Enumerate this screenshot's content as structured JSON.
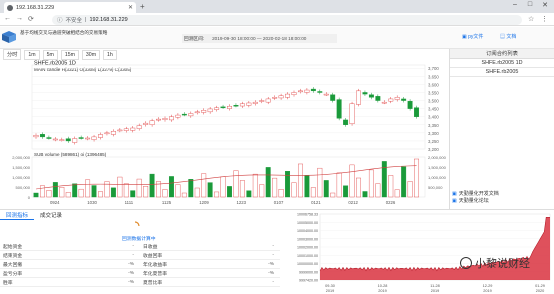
{
  "browser": {
    "tab_title": "192.168.31.229",
    "url": "192.168.31.229",
    "security": "不安全",
    "new_tab": "+",
    "win_min": "–",
    "win_max": "□",
    "win_close": "✕"
  },
  "app": {
    "description": "基于均线交叉与通道突破相结合的交易策略",
    "range_label": "回测区间:",
    "range_value": "2019-09-30 18:00:00 — 2020-02-18 18:00:00",
    "py_btn": "py文件",
    "doc_btn": "文档"
  },
  "timeframes": [
    "分时",
    "1m",
    "5m",
    "15m",
    "30m",
    "1h"
  ],
  "sidebar": {
    "header": "订阅合约列表",
    "items": [
      "SHFE.rb2005 1D",
      "SHFE.rb2005"
    ],
    "foot1": "天勤量化开发文档",
    "foot2": "天勤量化论坛"
  },
  "chart_data": [
    {
      "type": "line",
      "title": "SHFE.rb2005 1D",
      "main_label": "MAIN candle H(3321) O(3308) L(3279) C(3305)",
      "y_ticks": [
        "3,700",
        "3,650",
        "3,600",
        "3,550",
        "3,500",
        "3,450",
        "3,400",
        "3,350",
        "3,300",
        "3,250",
        "3,200"
      ],
      "x_ticks": [
        "0924",
        "1030",
        "1111",
        "1125",
        "1209",
        "1223",
        "0107",
        "0121",
        "0212",
        "0226"
      ],
      "close": [
        3285,
        3275,
        3270,
        3262,
        3258,
        3250,
        3265,
        3270,
        3268,
        3275,
        3290,
        3300,
        3310,
        3318,
        3325,
        3330,
        3345,
        3360,
        3375,
        3385,
        3390,
        3400,
        3410,
        3415,
        3420,
        3430,
        3440,
        3448,
        3455,
        3460,
        3465,
        3470,
        3480,
        3485,
        3490,
        3500,
        3510,
        3520,
        3530,
        3540,
        3550,
        3560,
        3565,
        3560,
        3550,
        3540,
        3500,
        3390,
        3350,
        3480,
        3560,
        3540,
        3520,
        3500,
        3490,
        3510,
        3520,
        3500,
        3450,
        3400
      ],
      "ylim": [
        3200,
        3720
      ]
    },
    {
      "type": "bar",
      "title": "SUB volume (589861) oi (1396485)",
      "y_ticks": [
        "2,000,000",
        "1,500,000",
        "1,000,000",
        "500,000",
        "0"
      ],
      "y2_ticks": [
        "2,000,000",
        "1,500,000",
        "1,000,000",
        "500,000"
      ]
    },
    {
      "type": "line",
      "title": "equity",
      "y_ticks": [
        "10006758.33",
        "10005000.00",
        "10004000.00",
        "10003000.00",
        "10002000.00",
        "10001000.00",
        "10000000.00",
        "9999000.00",
        "9997420.00"
      ],
      "x_ticks": [
        "09-30\n2019",
        "10-28\n2019",
        "11-28\n2019",
        "12-29\n2019",
        "01-29\n2020"
      ]
    }
  ],
  "bottom": {
    "tab1": "回测指标",
    "tab2": "成交记录",
    "loading": "回测数据计算中",
    "stats": [
      {
        "k1": "起始资金",
        "v1": "-",
        "k2": "日收益",
        "v2": "-"
      },
      {
        "k1": "结束资金",
        "v1": "-",
        "k2": "收益回率",
        "v2": "-"
      },
      {
        "k1": "最大回撤",
        "v1": "-%",
        "k2": "年化收益率",
        "v2": "-%"
      },
      {
        "k1": "盈亏分率",
        "v1": "-%",
        "k2": "年化夏普率",
        "v2": "-%"
      },
      {
        "k1": "胜率",
        "v1": "-%",
        "k2": "夏普比率",
        "v2": "-"
      }
    ]
  },
  "watermark": "小黎说财经"
}
